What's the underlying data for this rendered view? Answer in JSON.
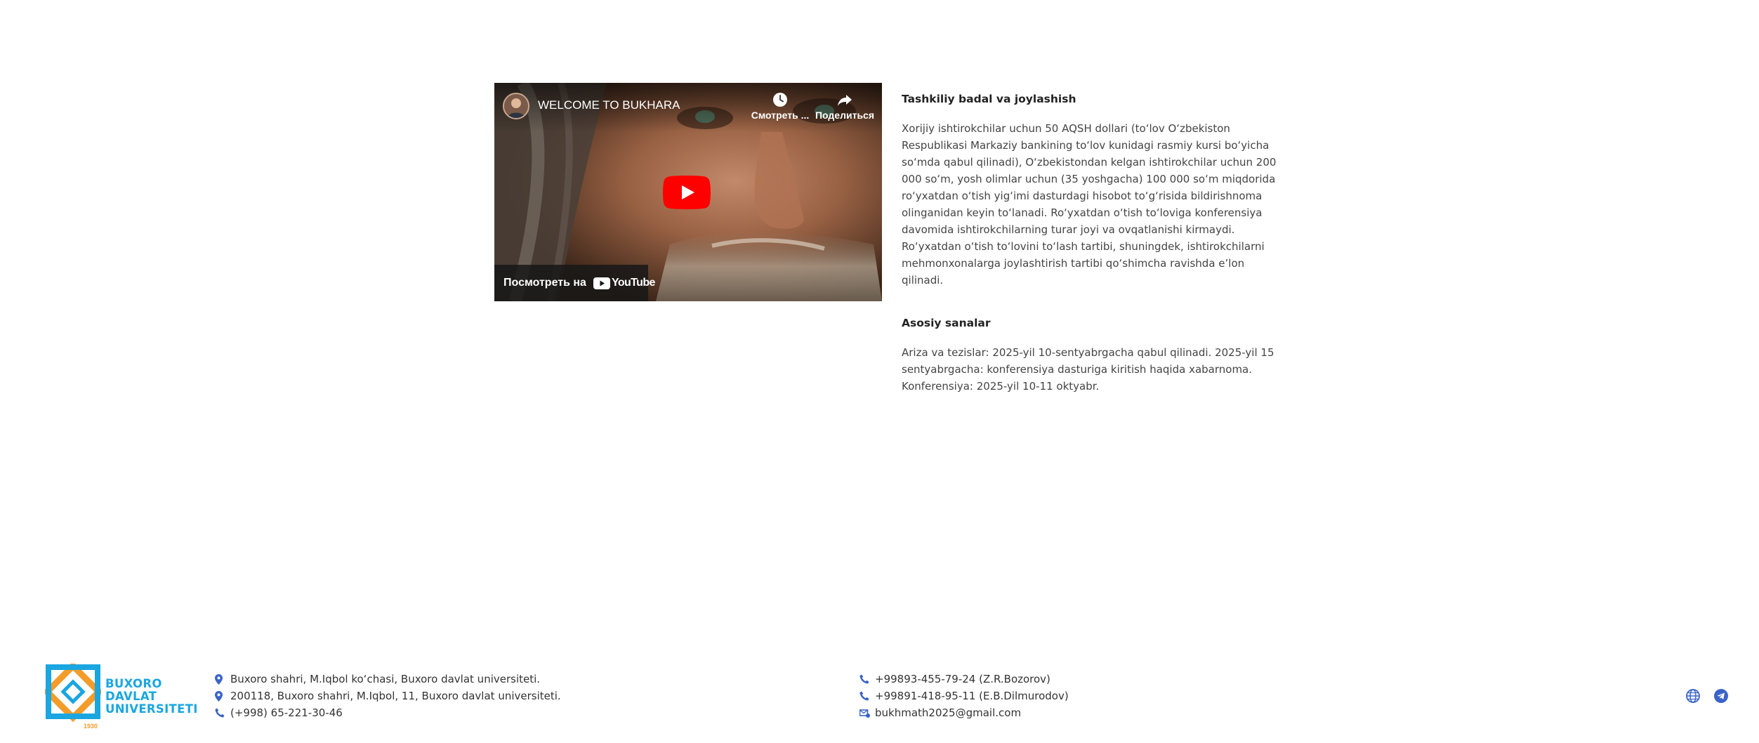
{
  "video": {
    "title": "WELCOME TO BUKHARA",
    "watch_later_label": "Смотреть ...",
    "share_label": "Поделиться",
    "watch_on_label": "Посмотреть на",
    "youtube_brand": "YouTube"
  },
  "info": {
    "sections": [
      {
        "heading": "Tashkiliy badal va joylashish",
        "text": "Xorijiy ishtirokchilar uchun 50 AQSH dollari (toʻlov Oʻzbekiston Respublikasi Markaziy bankining toʻlov kunidagi rasmiy kursi boʻyicha soʻmda qabul qilinadi), Oʻzbekistondan kelgan ishtirokchilar uchun 200 000 soʻm, yosh olimlar uchun (35 yoshgacha) 100 000 soʻm miqdorida roʻyxatdan oʻtish yigʻimi dasturdagi hisobot toʻgʻrisida bildirishnoma olinganidan keyin toʻlanadi. Roʻyxatdan oʻtish toʻloviga konferensiya davomida ishtirokchilarning turar joyi va ovqatlanishi kirmaydi. Roʻyxatdan oʻtish toʻlovini toʻlash tartibi, shuningdek, ishtirokchilarni mehmonxonalarga joylashtirish tartibi qoʻshimcha ravishda eʼlon qilinadi."
      },
      {
        "heading": "Asosiy sanalar",
        "text": "Ariza va tezislar: 2025-yil 10-sentyabrgacha qabul qilinadi. 2025-yil 15 sentyabrgacha: konferensiya dasturiga kiritish haqida xabarnoma. Konferensiya: 2025-yil 10-11 oktyabr."
      }
    ]
  },
  "footer": {
    "logo_lines": [
      "BUXORO",
      "DAVLAT",
      "UNIVERSITETI"
    ],
    "logo_year": "1930",
    "left_contacts": [
      {
        "icon": "map-pin-icon",
        "text": "Buxoro shahri, M.Iqbol koʻchasi, Buxoro davlat universiteti."
      },
      {
        "icon": "map-pin-icon",
        "text": "200118, Buxoro shahri, M.Iqbol, 11, Buxoro davlat universiteti."
      },
      {
        "icon": "phone-icon",
        "text": "(+998) 65-221-30-46"
      }
    ],
    "middle_contacts": [
      {
        "icon": "phone-icon",
        "text": "+99893-455-79-24 (Z.R.Bozorov)"
      },
      {
        "icon": "phone-icon",
        "text": "+99891-418-95-11 (E.B.Dilmurodov)"
      },
      {
        "icon": "mail-icon",
        "text": "bukhmath2025@gmail.com"
      }
    ],
    "social_icons": [
      "globe-icon",
      "telegram-icon"
    ]
  },
  "colors": {
    "accent_blue": "#1aa6e0",
    "accent_orange": "#f39c2a",
    "icon_blue": "#3b63c7",
    "youtube_red": "#ff0000"
  }
}
